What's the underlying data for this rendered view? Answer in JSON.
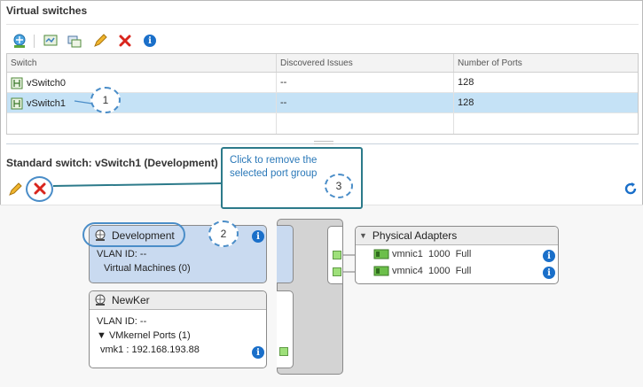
{
  "virtual_switches": {
    "title": "Virtual switches",
    "toolbar": {
      "add": "add-networking-icon",
      "edit_settings": "edit-settings-icon",
      "migrate": "migrate-icon",
      "edit": "pencil-icon",
      "remove": "red-x-icon",
      "info": "info-icon"
    },
    "columns": [
      "Switch",
      "Discovered Issues",
      "Number of Ports"
    ],
    "rows": [
      {
        "name": "vSwitch0",
        "issues": "--",
        "ports": "128",
        "selected": false
      },
      {
        "name": "vSwitch1",
        "issues": "--",
        "ports": "128",
        "selected": true
      }
    ]
  },
  "standard_switch": {
    "title": "Standard switch: vSwitch1 (Development)"
  },
  "port_groups": [
    {
      "name": "Development",
      "vlan": "VLAN ID: --",
      "detail": "Virtual Machines (0)"
    },
    {
      "name": "NewKer",
      "vlan": "VLAN ID: --",
      "detail": "VMkernel Ports (1)",
      "port": "vmk1 : 192.168.193.88"
    }
  ],
  "physical_adapters": {
    "title": "Physical Adapters",
    "items": [
      {
        "name": "vmnic1",
        "speed": "1000",
        "duplex": "Full"
      },
      {
        "name": "vmnic4",
        "speed": "1000",
        "duplex": "Full"
      }
    ]
  },
  "callouts": {
    "one": "1",
    "two": "2",
    "three": "3",
    "tooltip": "Click to remove the selected port group"
  },
  "colors": {
    "selected_row": "#c5e2f6",
    "accent_blue": "#1a6fc9",
    "callout_text": "#2a78b8",
    "remove_red": "#d9251d"
  }
}
